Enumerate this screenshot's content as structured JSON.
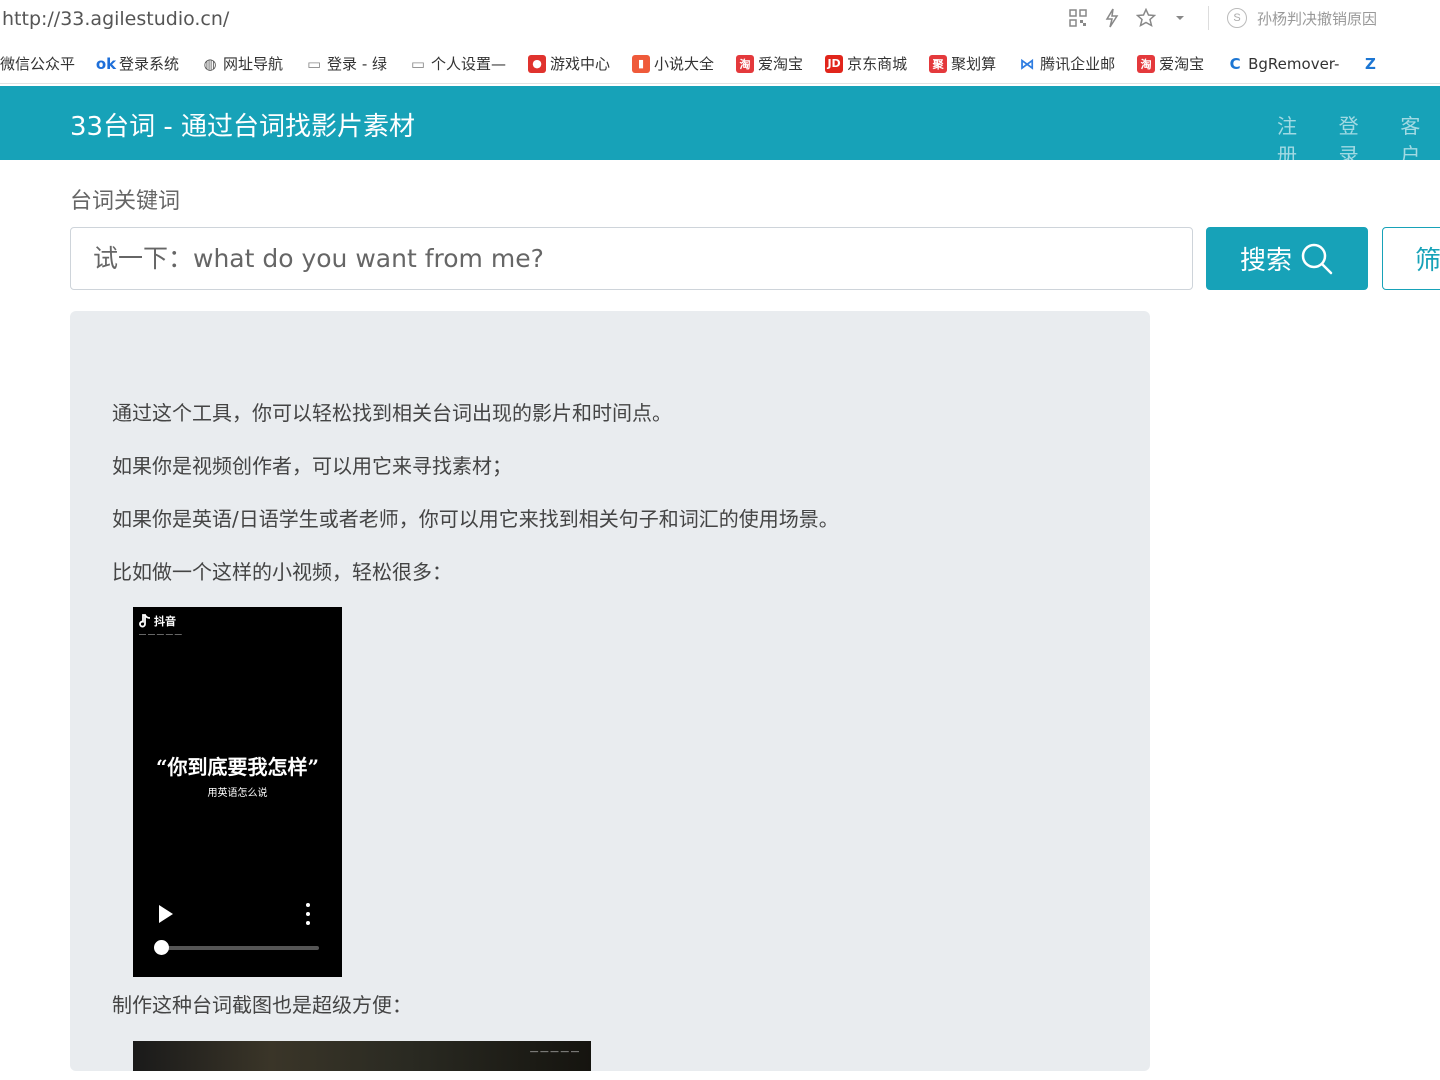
{
  "browser": {
    "url": "http://33.agilestudio.cn/",
    "search_hint": "孙杨判决撤销原因",
    "bookmarks": [
      {
        "label": "微信公众平",
        "icon": "none",
        "color": ""
      },
      {
        "label": "登录系统",
        "icon": "link-icon",
        "color": "#1e6fd9"
      },
      {
        "label": "网址导航",
        "icon": "globe-icon",
        "color": "#555555"
      },
      {
        "label": "登录 - 绿",
        "icon": "site-icon",
        "color": "#888888"
      },
      {
        "label": "个人设置—",
        "icon": "site-icon",
        "color": "#888888"
      },
      {
        "label": "游戏中心",
        "icon": "game-icon",
        "color": "#e0332e"
      },
      {
        "label": "小说大全",
        "icon": "book-icon",
        "color": "#ef5a3a"
      },
      {
        "label": "爱淘宝",
        "icon": "taobao-icon",
        "color": "#e4393c"
      },
      {
        "label": "京东商城",
        "icon": "jd-icon",
        "color": "#e1251b"
      },
      {
        "label": "聚划算",
        "icon": "juhuasuan-icon",
        "color": "#e4393c"
      },
      {
        "label": "腾讯企业邮",
        "icon": "mail-icon",
        "color": "#2f7de1"
      },
      {
        "label": "爱淘宝",
        "icon": "taobao-icon",
        "color": "#e4393c"
      },
      {
        "label": "BgRemover-",
        "icon": "cj-icon",
        "color": "#1c76d3"
      },
      {
        "label": "",
        "icon": "z-icon",
        "color": "#1c76d3"
      }
    ]
  },
  "site": {
    "title": "33台词 - 通过台词找影片素材",
    "nav": [
      "注册",
      "登录",
      "客户"
    ],
    "brand_color": "#17a2b8"
  },
  "search": {
    "label": "台词关键词",
    "placeholder": "试一下：what do you want from me?",
    "button_label": "搜索",
    "filter_label": "筛"
  },
  "intro": {
    "lines": [
      "通过这个工具，你可以轻松找到相关台词出现的影片和时间点。",
      "如果你是视频创作者，可以用它来寻找素材；",
      "如果你是英语/日语学生或者老师，你可以用它来找到相关句子和词汇的使用场景。",
      "比如做一个这样的小视频，轻松很多："
    ],
    "video": {
      "app_name": "抖音",
      "title": "“你到底要我怎样”",
      "subtitle": "用英语怎么说",
      "progress": 0.0
    },
    "screenshot_caption": "制作这种台词截图也是超级方便："
  }
}
